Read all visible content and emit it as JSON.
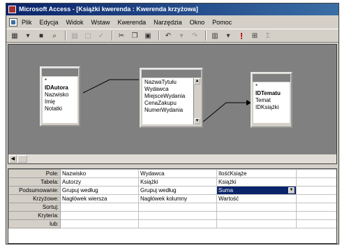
{
  "window": {
    "title": "Microsoft Access - [Książki kwerenda : Kwerenda krzyżowa]"
  },
  "menu": [
    "Plik",
    "Edycja",
    "Widok",
    "Wstaw",
    "Kwerenda",
    "Narzędzia",
    "Okno",
    "Pomoc"
  ],
  "toolbar": {
    "execute_label": "!",
    "execute_color": "#c00000"
  },
  "tables": [
    {
      "title": "",
      "fields": [
        "*",
        "IDAutora",
        "Nazwisko",
        "Imię",
        "Notatki"
      ],
      "key_index": 1
    },
    {
      "title": "",
      "fields": [
        "NazwaTytułu",
        "Wydawca",
        "MiejsceWydania",
        "CenaZakupu",
        "NumerWydania"
      ],
      "key_index": -1
    },
    {
      "title": "",
      "fields": [
        "*",
        "IDTematu",
        "Temat",
        "IDKsiążki"
      ],
      "key_index": 1
    }
  ],
  "grid": {
    "row_labels": [
      "Pole:",
      "Tabela:",
      "Podsumowanie:",
      "Krzyżowe:",
      "Sortuj:",
      "Kryteria:",
      "lub:"
    ],
    "columns": [
      [
        "Nazwisko",
        "Autorzy",
        "Grupuj według",
        "Nagłówek wiersza",
        "",
        "",
        ""
      ],
      [
        "Wydawca",
        "Książki",
        "Grupuj według",
        "Nagłówek kolumny",
        "",
        "",
        ""
      ],
      [
        "IlośćKsiąże",
        "Książki",
        "Suma",
        "Wartość",
        "",
        "",
        ""
      ],
      [
        "",
        "",
        "",
        "",
        "",
        "",
        ""
      ]
    ],
    "selected": {
      "col": 2,
      "row": 2
    }
  }
}
